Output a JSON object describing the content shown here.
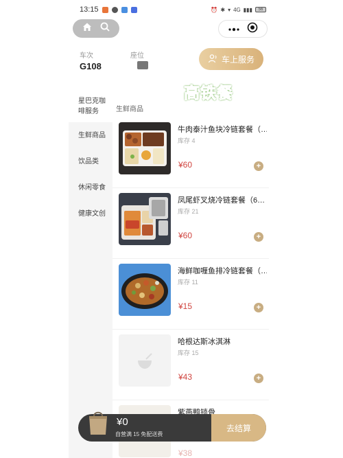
{
  "status_bar": {
    "time": "13:15",
    "signal": "4G",
    "battery": "56"
  },
  "top_pill": {
    "home_icon": "home-icon",
    "search_icon": "search-icon"
  },
  "mini_capsule": {
    "more_icon": "more-dots-icon",
    "close_icon": "target-icon"
  },
  "train": {
    "train_label": "车次",
    "seat_label": "座位",
    "train_number": "G108"
  },
  "service_button": {
    "label": "车上服务"
  },
  "banner": {
    "title": "高铁餐"
  },
  "sidebar": {
    "items": [
      {
        "label": "星巴克咖啡服务"
      },
      {
        "label": "生鲜商品"
      },
      {
        "label": "饮品类"
      },
      {
        "label": "休闲零食"
      },
      {
        "label": "健康文创"
      }
    ]
  },
  "main": {
    "section_title": "生鲜商品",
    "products": [
      {
        "name": "牛肉泰汁鱼块冷链套餐（…",
        "stock": "库存 4",
        "price": "¥60",
        "image": "beef-fish-meal"
      },
      {
        "name": "凤尾虾叉烧冷链套餐（6…",
        "stock": "库存 21",
        "price": "¥60",
        "image": "shrimp-char-siu-meal"
      },
      {
        "name": "海鲜咖喱鱼排冷链套餐（…",
        "stock": "库存 11",
        "price": "¥15",
        "image": "seafood-curry-meal"
      },
      {
        "name": "哈根达斯冰淇淋",
        "stock": "库存 15",
        "price": "¥43",
        "image": "placeholder"
      },
      {
        "name": "紫燕鸭锁骨",
        "stock": "",
        "price": "¥38",
        "image": "duck"
      }
    ]
  },
  "cart": {
    "amount": "¥0",
    "note": "自营满 15 免配送费",
    "checkout_label": "去结算"
  },
  "colors": {
    "accent_gold": "#d8b885",
    "price_red": "#d0443f",
    "banner_green": "#7ddc3c"
  }
}
